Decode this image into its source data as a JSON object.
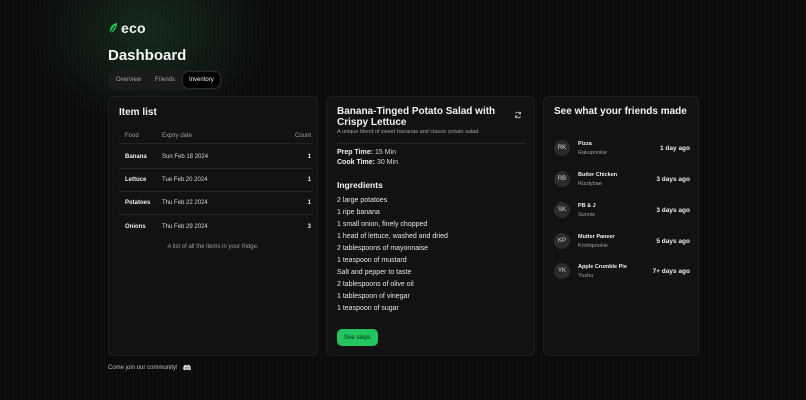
{
  "brand": {
    "name": "eco",
    "logo_icon": "leaf-icon",
    "accent": "#22c55e"
  },
  "page_title": "Dashboard",
  "tabs": [
    {
      "label": "Overview",
      "active": false
    },
    {
      "label": "Friends",
      "active": false
    },
    {
      "label": "Inventory",
      "active": true
    }
  ],
  "item_list": {
    "title": "Item list",
    "headers": [
      "Food",
      "Expiry date",
      "Count"
    ],
    "rows": [
      {
        "food": "Banana",
        "expiry": "Sun Feb 18 2024",
        "count": "1"
      },
      {
        "food": "Lettuce",
        "expiry": "Tue Feb 20 2024",
        "count": "1"
      },
      {
        "food": "Potatoes",
        "expiry": "Thu Feb 22 2024",
        "count": "1"
      },
      {
        "food": "Onions",
        "expiry": "Thu Feb 29 2024",
        "count": "3"
      }
    ],
    "caption": "A list of all the items in your fridge."
  },
  "recipe": {
    "title": "Banana-Tinged Potato Salad with Crispy Lettuce",
    "description": "A unique blend of sweet bananas and classic potato salad.",
    "prep_label": "Prep Time:",
    "prep_value": "15 Min",
    "cook_label": "Cook Time:",
    "cook_value": "30 Min",
    "ingredients_title": "Ingredients",
    "ingredients": [
      "2 large potatoes",
      "1 ripe banana",
      "1 small onion, finely chopped",
      "1 head of lettuce, washed and dried",
      "2 tablespoons of mayonnaise",
      "1 teaspoon of mustard",
      "Salt and pepper to taste",
      "2 tablespoons of olive oil",
      "1 tablespoon of vinegar",
      "1 teaspoon of sugar"
    ],
    "steps_button": "See steps",
    "refresh_icon": "refresh-icon"
  },
  "friends": {
    "title": "See what your friends made",
    "items": [
      {
        "initials": "RK",
        "dish": "Pizza",
        "name": "Rakupookie",
        "ago": "1 day ago"
      },
      {
        "initials": "RB",
        "dish": "Butter Chicken",
        "name": "Rizzlybae",
        "ago": "3 days ago"
      },
      {
        "initials": "SK",
        "dish": "PB & J",
        "name": "Sunnie",
        "ago": "3 days ago"
      },
      {
        "initials": "KP",
        "dish": "Mutter Paneer",
        "name": "Krishipookie",
        "ago": "5 days ago"
      },
      {
        "initials": "YK",
        "dish": "Apple Crumble Pie",
        "name": "Yushu",
        "ago": "7+ days ago"
      }
    ]
  },
  "footer": {
    "text": "Come join our community!",
    "icon": "discord-icon"
  }
}
